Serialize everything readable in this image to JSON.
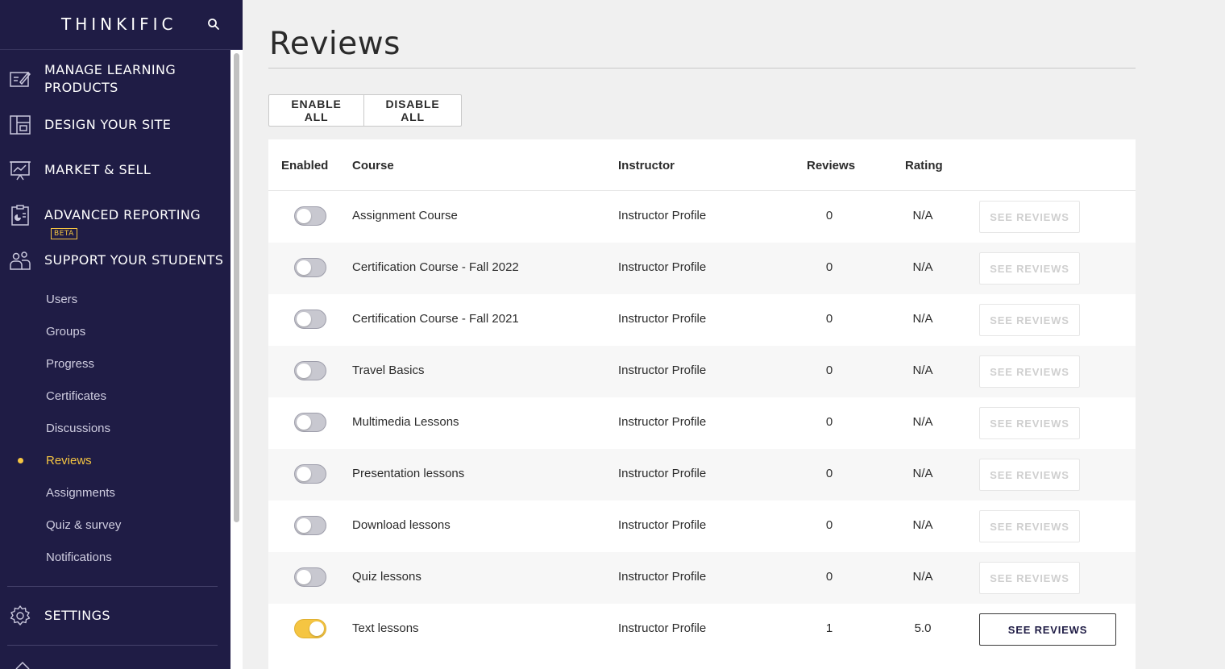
{
  "sidebar": {
    "brand": "THINKIFIC",
    "sections": [
      {
        "label_lines": [
          "MANAGE LEARNING",
          "PRODUCTS"
        ],
        "icon": "edit-document-icon"
      },
      {
        "label_lines": [
          "DESIGN YOUR SITE"
        ],
        "icon": "layout-icon"
      },
      {
        "label_lines": [
          "MARKET & SELL"
        ],
        "icon": "presentation-chart-icon"
      },
      {
        "label_lines": [
          "ADVANCED REPORTING"
        ],
        "badge": "BETA",
        "icon": "report-clipboard-icon"
      },
      {
        "label_lines": [
          "SUPPORT YOUR STUDENTS"
        ],
        "icon": "students-icon"
      }
    ],
    "sub_items": [
      "Users",
      "Groups",
      "Progress",
      "Certificates",
      "Discussions",
      "Reviews",
      "Assignments",
      "Quiz & survey",
      "Notifications"
    ],
    "active_sub_item": "Reviews",
    "settings_label": "SETTINGS"
  },
  "page": {
    "title": "Reviews",
    "enable_all": "ENABLE ALL",
    "disable_all": "DISABLE ALL"
  },
  "table": {
    "headers": {
      "enabled": "Enabled",
      "course": "Course",
      "instructor": "Instructor",
      "reviews": "Reviews",
      "rating": "Rating"
    },
    "see_reviews_label": "SEE REVIEWS",
    "rows": [
      {
        "course": "Assignment Course",
        "instructor": "Instructor Profile",
        "reviews": "0",
        "rating": "N/A",
        "enabled": false
      },
      {
        "course": "Certification Course - Fall 2022",
        "instructor": "Instructor Profile",
        "reviews": "0",
        "rating": "N/A",
        "enabled": false
      },
      {
        "course": "Certification Course - Fall 2021",
        "instructor": "Instructor Profile",
        "reviews": "0",
        "rating": "N/A",
        "enabled": false
      },
      {
        "course": "Travel Basics",
        "instructor": "Instructor Profile",
        "reviews": "0",
        "rating": "N/A",
        "enabled": false
      },
      {
        "course": "Multimedia Lessons",
        "instructor": "Instructor Profile",
        "reviews": "0",
        "rating": "N/A",
        "enabled": false
      },
      {
        "course": "Presentation lessons",
        "instructor": "Instructor Profile",
        "reviews": "0",
        "rating": "N/A",
        "enabled": false
      },
      {
        "course": "Download lessons",
        "instructor": "Instructor Profile",
        "reviews": "0",
        "rating": "N/A",
        "enabled": false
      },
      {
        "course": "Quiz lessons",
        "instructor": "Instructor Profile",
        "reviews": "0",
        "rating": "N/A",
        "enabled": false
      },
      {
        "course": "Text lessons",
        "instructor": "Instructor Profile",
        "reviews": "1",
        "rating": "5.0",
        "enabled": true
      }
    ]
  },
  "colors": {
    "sidebar_bg": "#1f1c45",
    "accent": "#f5c542",
    "page_bg": "#f0f0f0"
  }
}
